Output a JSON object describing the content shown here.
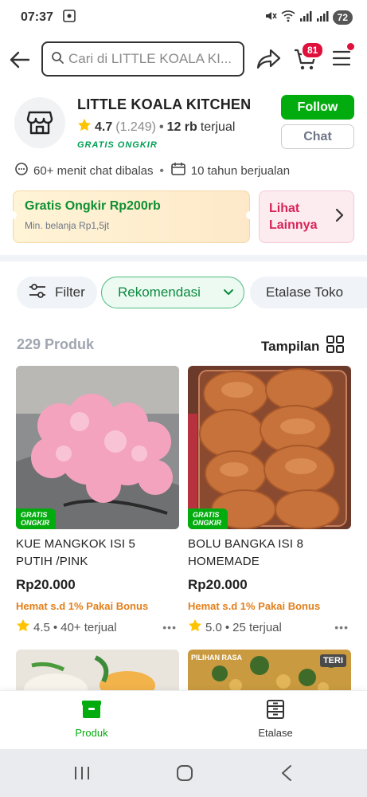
{
  "status_bar": {
    "time": "07:37",
    "battery": "72"
  },
  "search": {
    "placeholder": "Cari di LITTLE KOALA KI..."
  },
  "cart": {
    "badge": "81"
  },
  "shop": {
    "name": "LITTLE KOALA KITCHEN",
    "rating": "4.7",
    "rating_count": "(1.249)",
    "sold_number": "12 rb",
    "sold_word": "terjual",
    "free_shipping_tag": "GRATIS ONGKIR",
    "follow_label": "Follow",
    "chat_label": "Chat",
    "chat_response": "60+ menit chat dibalas",
    "selling_duration": "10 tahun berjualan"
  },
  "promo": {
    "title": "Gratis Ongkir Rp200rb",
    "subtitle": "Min. belanja Rp1,5jt",
    "more_label": "Lihat Lainnya"
  },
  "filters": {
    "filter_label": "Filter",
    "sort_label": "Rekomendasi",
    "etalase_label": "Etalase Toko"
  },
  "list": {
    "count_label": "229 Produk",
    "view_label": "Tampilan"
  },
  "products": [
    {
      "badge_line1": "GRATIS",
      "badge_line2": "ONGKIR",
      "name_line1": "KUE MANGKOK ISI 5",
      "name_line2": "PUTIH /PINK",
      "price": "Rp20.000",
      "bonus": "Hemat s.d  1% Pakai Bonus",
      "rating": "4.5",
      "sold": "40+ terjual",
      "more": "•••"
    },
    {
      "badge_line1": "GRATIS",
      "badge_line2": "ONGKIR",
      "name_line1": "BOLU BANGKA ISI 8",
      "name_line2": "HOMEMADE",
      "price": "Rp20.000",
      "bonus": "Hemat s.d  1% Pakai Bonus",
      "rating": "5.0",
      "sold": "25 terjual",
      "more": "•••"
    }
  ],
  "partial_products": [
    {
      "overlay_text": ""
    },
    {
      "overlay_text": "PILIHAN RASA",
      "corner_tag": "TERI"
    }
  ],
  "bottom_nav": {
    "produk_label": "Produk",
    "etalase_label": "Etalase"
  },
  "colors": {
    "accent": "#03ac0e",
    "badge_red": "#e0103c",
    "bonus_orange": "#e27f1a",
    "promo_green": "#0e8f33",
    "more_pink": "#d6245a"
  }
}
